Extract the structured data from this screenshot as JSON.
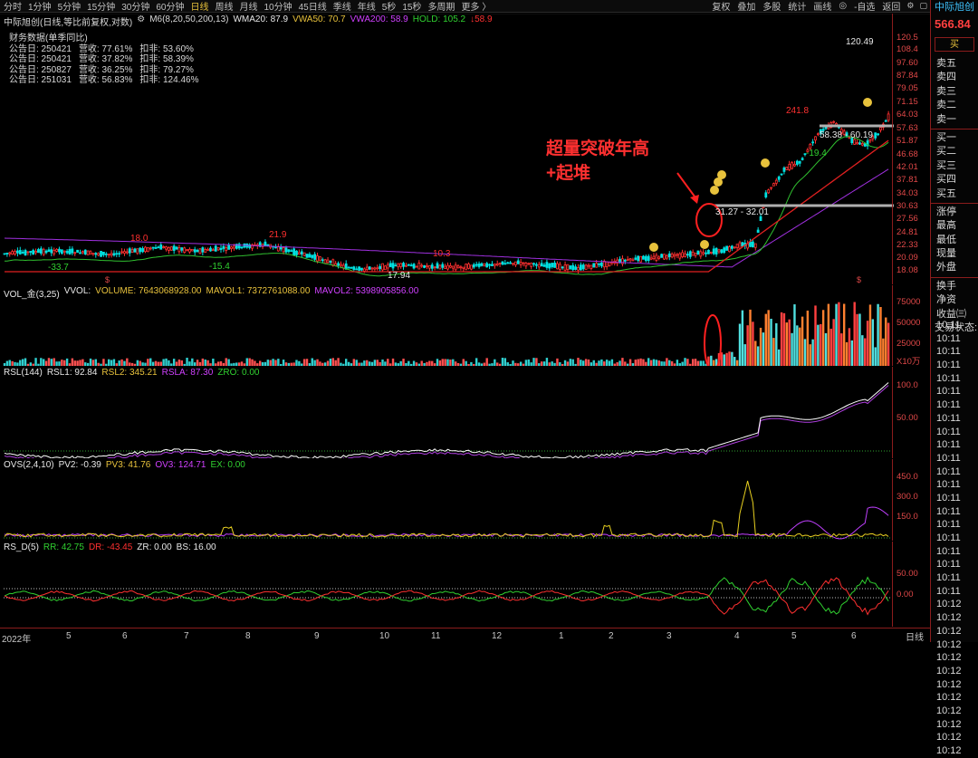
{
  "toolbar": {
    "periods": [
      "分时",
      "1分钟",
      "5分钟",
      "15分钟",
      "30分钟",
      "60分钟",
      "日线",
      "周线",
      "月线",
      "10分钟",
      "45日线",
      "季线",
      "年线",
      "5秒",
      "15秒",
      "多周期",
      "更多 〉"
    ],
    "active_period": "日线",
    "tools": [
      "复权",
      "叠加",
      "多股",
      "统计",
      "画线",
      "◎",
      "-自选",
      "返回"
    ],
    "icons": [
      "settings-icon",
      "window-icon"
    ]
  },
  "main_legend": {
    "title": "中际旭创(日线,等比前复权,对数)",
    "m6": "M6(8,20,50,200,13)",
    "wma20": "WMA20: 87.9",
    "vwa50": "VWA50: 70.7",
    "vwa200": "VWA200: 58.9",
    "hold": "HOLD: 105.2",
    "hold_delta": "↓58.9"
  },
  "financials": {
    "title": "财务数据(单季同比)",
    "rows": [
      {
        "date": "公告日: 250421",
        "revenue": "营收: 77.61%",
        "profit": "扣非: 53.60%"
      },
      {
        "date": "公告日: 250421",
        "revenue": "营收: 37.82%",
        "profit": "扣非: 58.39%"
      },
      {
        "date": "公告日: 250827",
        "revenue": "营收: 36.25%",
        "profit": "扣非: 79.27%"
      },
      {
        "date": "公告日: 251031",
        "revenue": "营收: 56.83%",
        "profit": "扣非: 124.46%"
      }
    ]
  },
  "price_axis": [
    "120.5",
    "108.4",
    "97.60",
    "87.84",
    "79.05",
    "71.15",
    "64.03",
    "57.63",
    "51.87",
    "46.68",
    "42.01",
    "37.81",
    "34.03",
    "30.63",
    "27.56",
    "24.81",
    "22.33",
    "20.09",
    "18.08"
  ],
  "chart_labels": {
    "high_label": "120.49",
    "zone1": "58.38 - 60.19",
    "zone2": "31.27 - 32.01",
    "peak1": "241.8",
    "low1": "-19.4",
    "low_label": "17.94",
    "osc_labels": [
      "18.0",
      "-33.7",
      "-15.4",
      "21.9",
      "10.3"
    ]
  },
  "annotation": {
    "line1": "超量突破年高",
    "line2": "+起堆"
  },
  "vol_legend": {
    "name": "VOL_金(3,25)",
    "vvol": "VVOL:",
    "volume": "VOLUME: 7643068928.00",
    "mavol1": "MAVOL1: 7372761088.00",
    "mavol2": "MAVOL2: 5398905856.00"
  },
  "vol_axis": [
    "75000",
    "50000",
    "25000"
  ],
  "vol_unit": "X10万",
  "rsl_legend": {
    "name": "RSL(144)",
    "rsl1": "RSL1: 92.84",
    "rsl2": "RSL2: 345.21",
    "rsla": "RSLA: 87.30",
    "zro": "ZRO: 0.00"
  },
  "rsl_axis": [
    "100.0",
    "50.00"
  ],
  "ovs_legend": {
    "name": "OVS(2,4,10)",
    "pv2": "PV2: -0.39",
    "pv3": "PV3: 41.76",
    "ov3": "OV3: 124.71",
    "ex": "EX: 0.00"
  },
  "ovs_axis": [
    "450.0",
    "300.0",
    "150.0"
  ],
  "rsd_legend": {
    "name": "RS_D(5)",
    "rr": "RR: 42.75",
    "dr": "DR: -43.45",
    "zr": "ZR: 0.00",
    "bs": "BS: 16.00"
  },
  "rsd_axis": [
    "50.00",
    "0.00"
  ],
  "date_axis": [
    "2022年",
    "5",
    "6",
    "7",
    "8",
    "9",
    "10",
    "11",
    "12",
    "1",
    "2",
    "3",
    "4",
    "5",
    "6"
  ],
  "axis_mode": "日线",
  "sidebar": {
    "title": "中际旭创",
    "price": "566.84",
    "buy_button": "买",
    "sell_levels": [
      "卖五",
      "卖四",
      "卖三",
      "卖二",
      "卖一"
    ],
    "buy_levels": [
      "买一",
      "买二",
      "买三",
      "买四",
      "买五"
    ],
    "stats": [
      "涨停",
      "最高",
      "最低",
      "现量",
      "外盘"
    ],
    "extra": [
      "换手",
      "净资",
      "收益㈢"
    ],
    "trade_status": "交易状态:",
    "times": [
      "10:11",
      "10:11",
      "10:11",
      "10:11",
      "10:11",
      "10:11",
      "10:11",
      "10:11",
      "10:11",
      "10:11",
      "10:11",
      "10:11",
      "10:11",
      "10:11",
      "10:11",
      "10:11",
      "10:11",
      "10:11",
      "10:11",
      "10:11",
      "10:11",
      "10:12",
      "10:12",
      "10:12",
      "10:12",
      "10:12",
      "10:12",
      "10:12",
      "10:12",
      "10:12",
      "10:12",
      "10:12",
      "10:12"
    ]
  },
  "colors": {
    "up": "#ff3030",
    "down": "#00e0e0",
    "accent": "#e8c23c",
    "magenta": "#d040ff",
    "green": "#30d030",
    "axis": "#8b1c1c"
  }
}
